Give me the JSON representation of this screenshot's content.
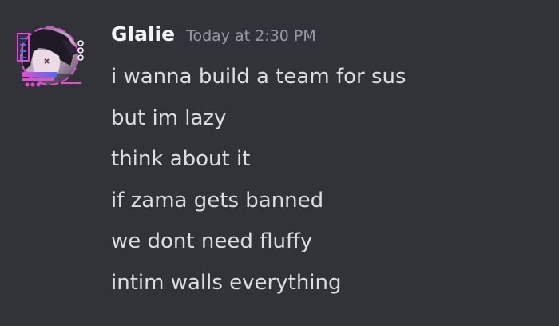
{
  "message": {
    "author": "Glalie",
    "timestamp": "Today at 2:30 PM",
    "avatar_icon": "anime-character-avatar-icon",
    "lines": [
      "i wanna build a team for sus",
      "but im lazy",
      "think about it",
      "if zama gets banned",
      "we dont need fluffy",
      "intim walls everything"
    ]
  },
  "colors": {
    "background": "#313338",
    "username": "#f2f3f5",
    "timestamp": "#949ba4",
    "message_text": "#dbdee1",
    "avatar_accent": "#e64bd8"
  }
}
